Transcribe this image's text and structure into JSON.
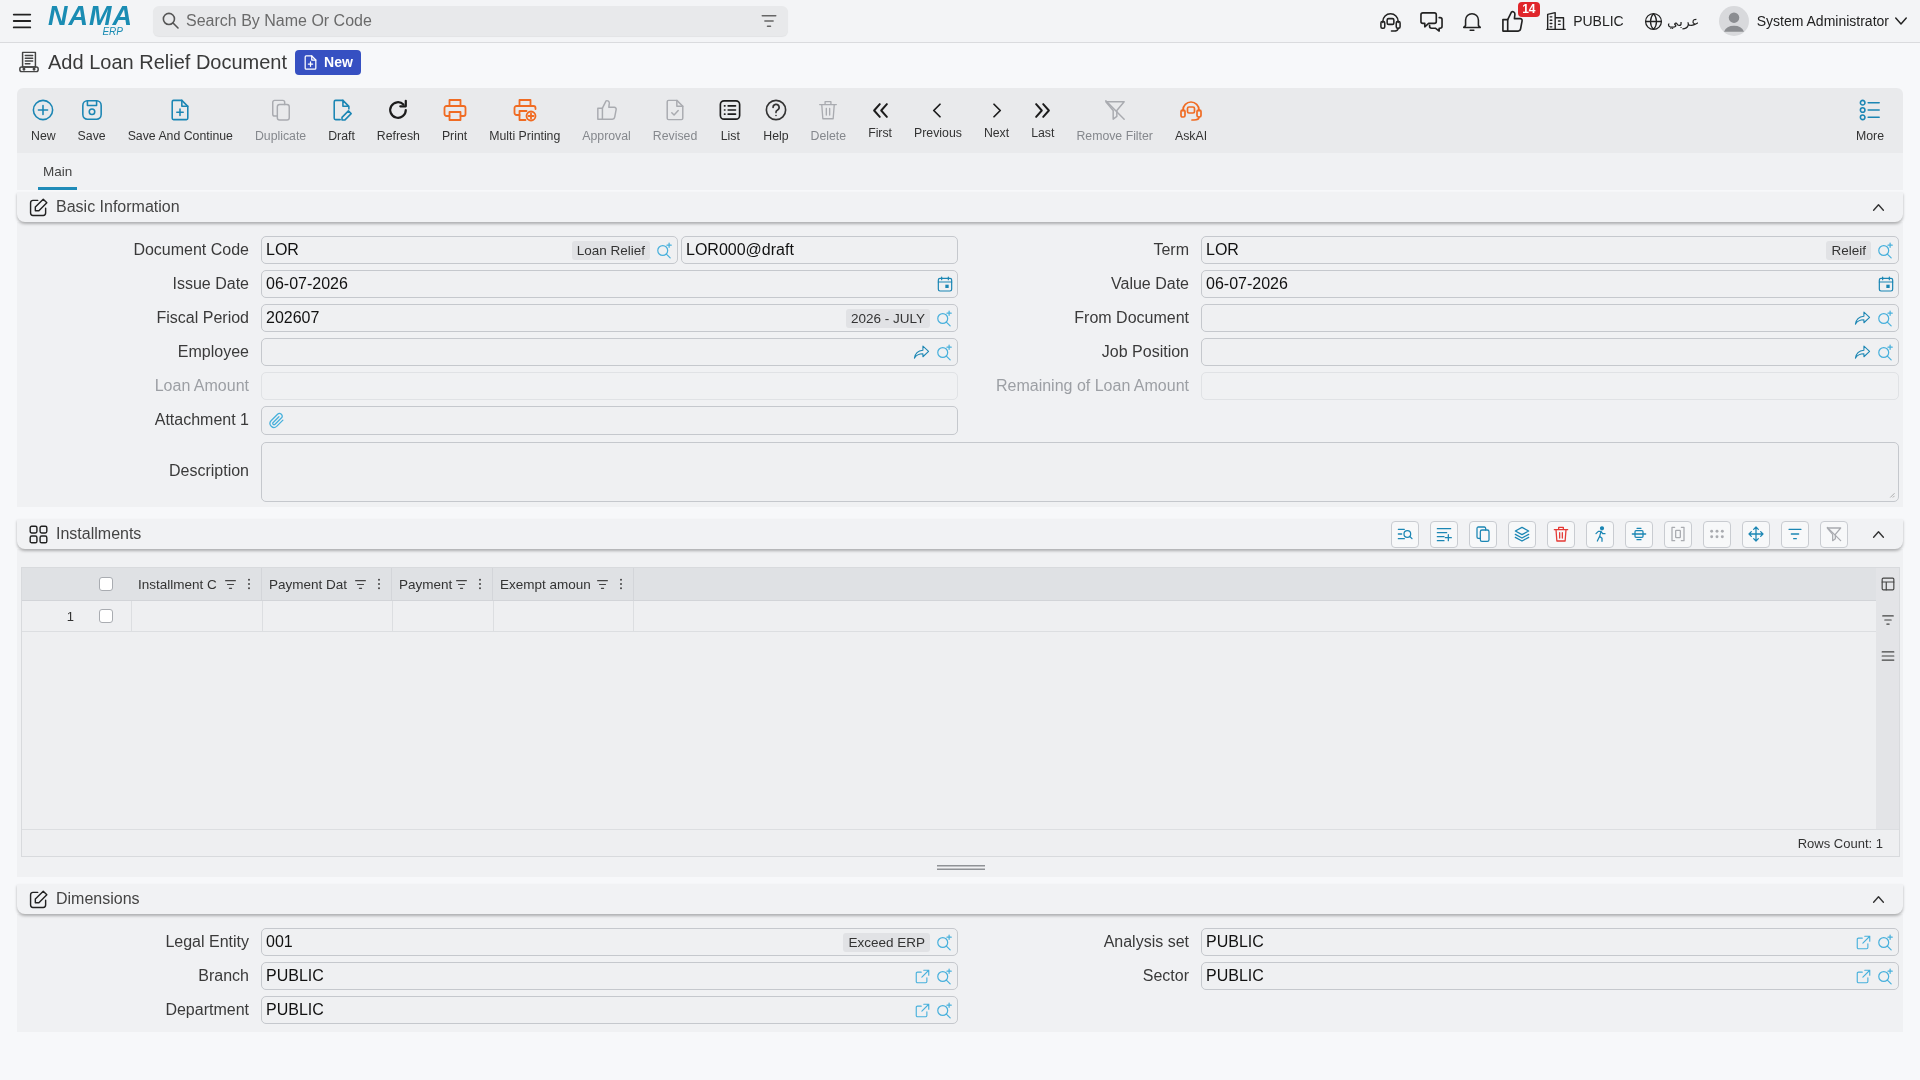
{
  "top_bar": {
    "logo": {
      "text": "NAMA",
      "subtext": "ERP"
    },
    "search": {
      "placeholder": "Search By Name Or Code"
    },
    "likes_badge": "14",
    "company": "PUBLIC",
    "language": "عربي",
    "user": "System Administrator"
  },
  "page_header": {
    "title": "Add Loan Relief Document",
    "status": "New"
  },
  "toolbar": {
    "actions": [
      {
        "label": "New",
        "disabled": false
      },
      {
        "label": "Save",
        "disabled": false
      },
      {
        "label": "Save And Continue",
        "disabled": false
      },
      {
        "label": "Duplicate",
        "disabled": true
      },
      {
        "label": "Draft",
        "disabled": false
      },
      {
        "label": "Refresh",
        "disabled": false
      },
      {
        "label": "Print",
        "disabled": false
      },
      {
        "label": "Multi Printing",
        "disabled": false
      },
      {
        "label": "Approval",
        "disabled": true
      },
      {
        "label": "Revised",
        "disabled": true
      },
      {
        "label": "List",
        "disabled": false
      },
      {
        "label": "Help",
        "disabled": false
      },
      {
        "label": "Delete",
        "disabled": true
      },
      {
        "label": "First",
        "disabled": false
      },
      {
        "label": "Previous",
        "disabled": false
      },
      {
        "label": "Next",
        "disabled": false
      },
      {
        "label": "Last",
        "disabled": false
      },
      {
        "label": "Remove Filter",
        "disabled": true
      },
      {
        "label": "AskAI",
        "disabled": false
      }
    ],
    "more": {
      "label": "More"
    }
  },
  "tabs": [
    {
      "label": "Main",
      "selected": true
    }
  ],
  "basic_information": {
    "title": "Basic Information",
    "expanded": true,
    "left_fields": [
      {
        "label": "Document Code",
        "kind": "code",
        "value": "LOR",
        "tag": "Loan Relief",
        "serial": "LOR000@draft",
        "disabled": false
      },
      {
        "label": "Issue Date",
        "kind": "date",
        "value": "06-07-2026",
        "disabled": false
      },
      {
        "label": "Fiscal Period",
        "kind": "lookup",
        "value": "202607",
        "tag": "2026 - JULY",
        "disabled": false
      },
      {
        "label": "Employee",
        "kind": "reference",
        "disabled": false
      },
      {
        "label": "Loan Amount",
        "kind": "number",
        "disabled": true
      },
      {
        "label": "Attachment 1",
        "kind": "attachment",
        "disabled": false
      }
    ],
    "right_fields": [
      {
        "label": "Term",
        "kind": "lookup",
        "value": "LOR",
        "tag": "Releif",
        "disabled": false
      },
      {
        "label": "Value Date",
        "kind": "date",
        "value": "06-07-2026",
        "disabled": false
      },
      {
        "label": "From Document",
        "kind": "reference",
        "disabled": false
      },
      {
        "label": "Job Position",
        "kind": "reference",
        "disabled": false
      },
      {
        "label": "Remaining of Loan Amount",
        "kind": "number",
        "disabled": true
      }
    ],
    "description": {
      "label": "Description"
    }
  },
  "installments": {
    "title": "Installments",
    "expanded": true,
    "tools": [
      {
        "disabled": false
      },
      {
        "disabled": false
      },
      {
        "disabled": false
      },
      {
        "disabled": false
      },
      {
        "disabled": false
      },
      {
        "disabled": false
      },
      {
        "disabled": false
      },
      {
        "disabled": true
      },
      {
        "disabled": true
      },
      {
        "disabled": false
      },
      {
        "disabled": false
      },
      {
        "disabled": true
      }
    ],
    "table": {
      "select_all_checked": false,
      "columns": [
        {
          "label": "Installment C"
        },
        {
          "label": "Payment Dat"
        },
        {
          "label": "Payment"
        },
        {
          "label": "Exempt amoun"
        }
      ],
      "rows": [
        {
          "number": "1",
          "checked": false
        }
      ],
      "rows_count": "Rows Count: 1"
    }
  },
  "dimensions": {
    "title": "Dimensions",
    "expanded": true,
    "left_fields": [
      {
        "label": "Legal Entity",
        "kind": "lookup",
        "value": "001",
        "tag": "Exceed ERP",
        "disabled": false
      },
      {
        "label": "Branch",
        "kind": "link",
        "value": "PUBLIC",
        "disabled": false
      },
      {
        "label": "Department",
        "kind": "link",
        "value": "PUBLIC",
        "disabled": false
      }
    ],
    "right_fields": [
      {
        "label": "Analysis set",
        "kind": "link",
        "value": "PUBLIC",
        "disabled": false
      },
      {
        "label": "Sector",
        "kind": "link",
        "value": "PUBLIC",
        "disabled": false
      }
    ]
  }
}
